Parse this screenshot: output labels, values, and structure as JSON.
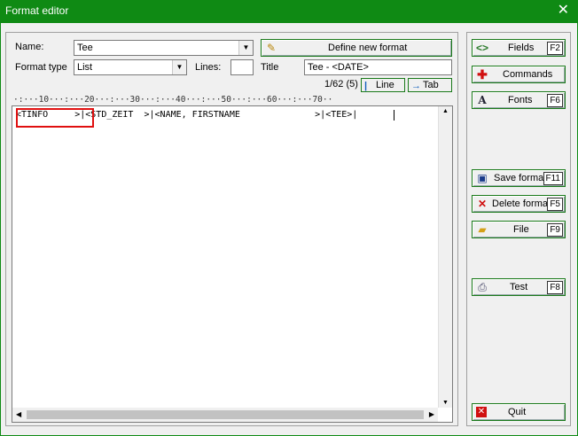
{
  "window": {
    "title": "Format editor",
    "close_glyph": "✕"
  },
  "form": {
    "name_label": "Name:",
    "name_value": "Tee",
    "define_button": "Define new format",
    "format_type_label": "Format type",
    "format_type_value": "List",
    "lines_label": "Lines:",
    "lines_value": "",
    "title_label": "Title",
    "title_value": "Tee - <DATE>",
    "position": "1/62 (5)",
    "line_button": "Line",
    "tab_button": "Tab"
  },
  "ruler": "·:···10···:···20···:···30···:···40···:···50···:···60···:···70··",
  "editor": {
    "content": "<TINFO     >|<STD_ZEIT  >|<NAME, FIRSTNAME              >|<TEE>|"
  },
  "sidebar": {
    "fields": {
      "label": "Fields",
      "key": "F2"
    },
    "commands": {
      "label": "Commands"
    },
    "fonts": {
      "label": "Fonts",
      "key": "F6"
    },
    "save_format": {
      "label": "Save format",
      "key": "F11"
    },
    "delete_format": {
      "label": "Delete forma",
      "key": "F5"
    },
    "file": {
      "label": "File",
      "key": "F9"
    },
    "test": {
      "label": "Test",
      "key": "F8"
    },
    "quit": {
      "label": "Quit"
    }
  },
  "colors": {
    "accent": "#0f8a14",
    "highlight": "#e01010"
  }
}
